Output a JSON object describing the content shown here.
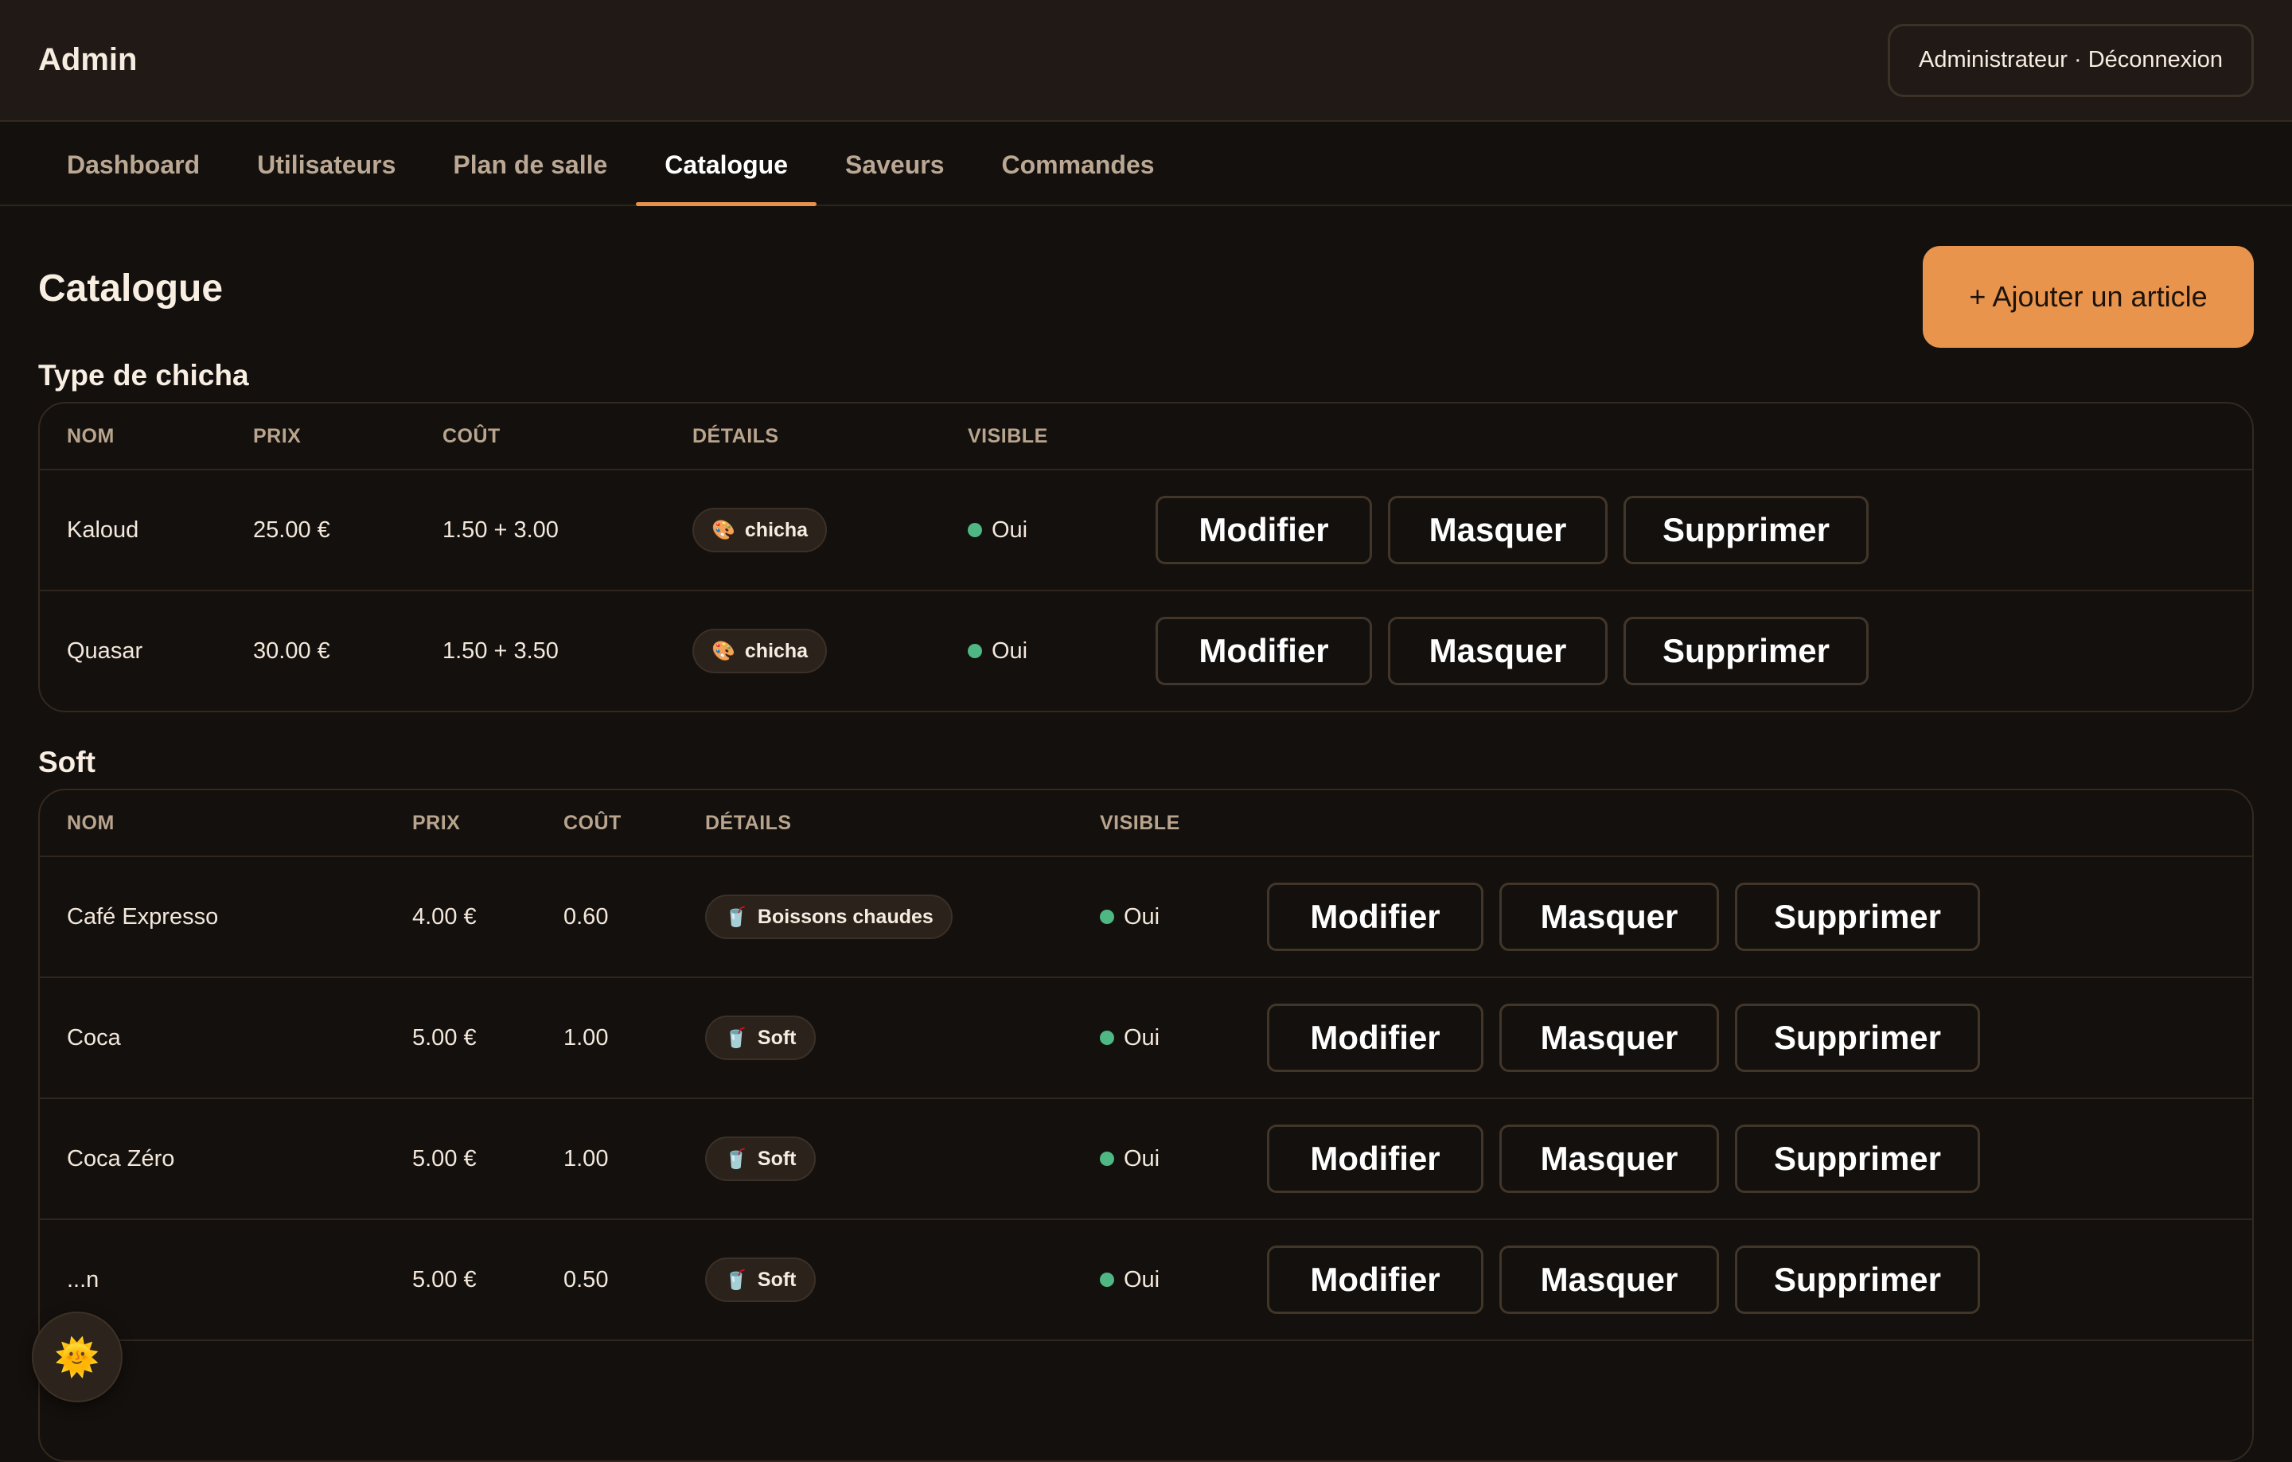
{
  "app": {
    "title": "Admin",
    "user_menu": "Administrateur · Déconnexion"
  },
  "tabs": [
    {
      "label": "Dashboard"
    },
    {
      "label": "Utilisateurs"
    },
    {
      "label": "Plan de salle"
    },
    {
      "label": "Catalogue",
      "active": true
    },
    {
      "label": "Saveurs"
    },
    {
      "label": "Commandes"
    }
  ],
  "page": {
    "title": "Catalogue",
    "add_button": "+ Ajouter un article"
  },
  "columns": {
    "nom": "NOM",
    "prix": "PRIX",
    "cout": "COÛT",
    "details": "DÉTAILS",
    "visible": "VISIBLE"
  },
  "actions": {
    "modifier": "Modifier",
    "masquer": "Masquer",
    "supprimer": "Supprimer"
  },
  "sections": [
    {
      "title": "Type de chicha",
      "rows": [
        {
          "nom": "Kaloud",
          "prix": "25.00 €",
          "cout": "1.50 + 3.00",
          "detail": "chicha",
          "detail_icon": "palette-icon",
          "visible": "Oui"
        },
        {
          "nom": "Quasar",
          "prix": "30.00 €",
          "cout": "1.50 + 3.50",
          "detail": "chicha",
          "detail_icon": "palette-icon",
          "visible": "Oui"
        }
      ]
    },
    {
      "title": "Soft",
      "rows": [
        {
          "nom": "Café Expresso",
          "prix": "4.00 €",
          "cout": "0.60",
          "detail": "Boissons chaudes",
          "detail_icon": "cup-icon",
          "visible": "Oui"
        },
        {
          "nom": "Coca",
          "prix": "5.00 €",
          "cout": "1.00",
          "detail": "Soft",
          "detail_icon": "cup-icon",
          "visible": "Oui"
        },
        {
          "nom": "Coca Zéro",
          "prix": "5.00 €",
          "cout": "1.00",
          "detail": "Soft",
          "detail_icon": "cup-icon",
          "visible": "Oui"
        },
        {
          "nom": "...n",
          "prix": "5.00 €",
          "cout": "0.50",
          "detail": "Soft",
          "detail_icon": "cup-icon",
          "visible": "Oui"
        }
      ]
    }
  ],
  "theme": {
    "accent": "#e8944d",
    "status_ok": "#4fb783",
    "background": "#14100d"
  },
  "fab_icon": "sun-icon"
}
